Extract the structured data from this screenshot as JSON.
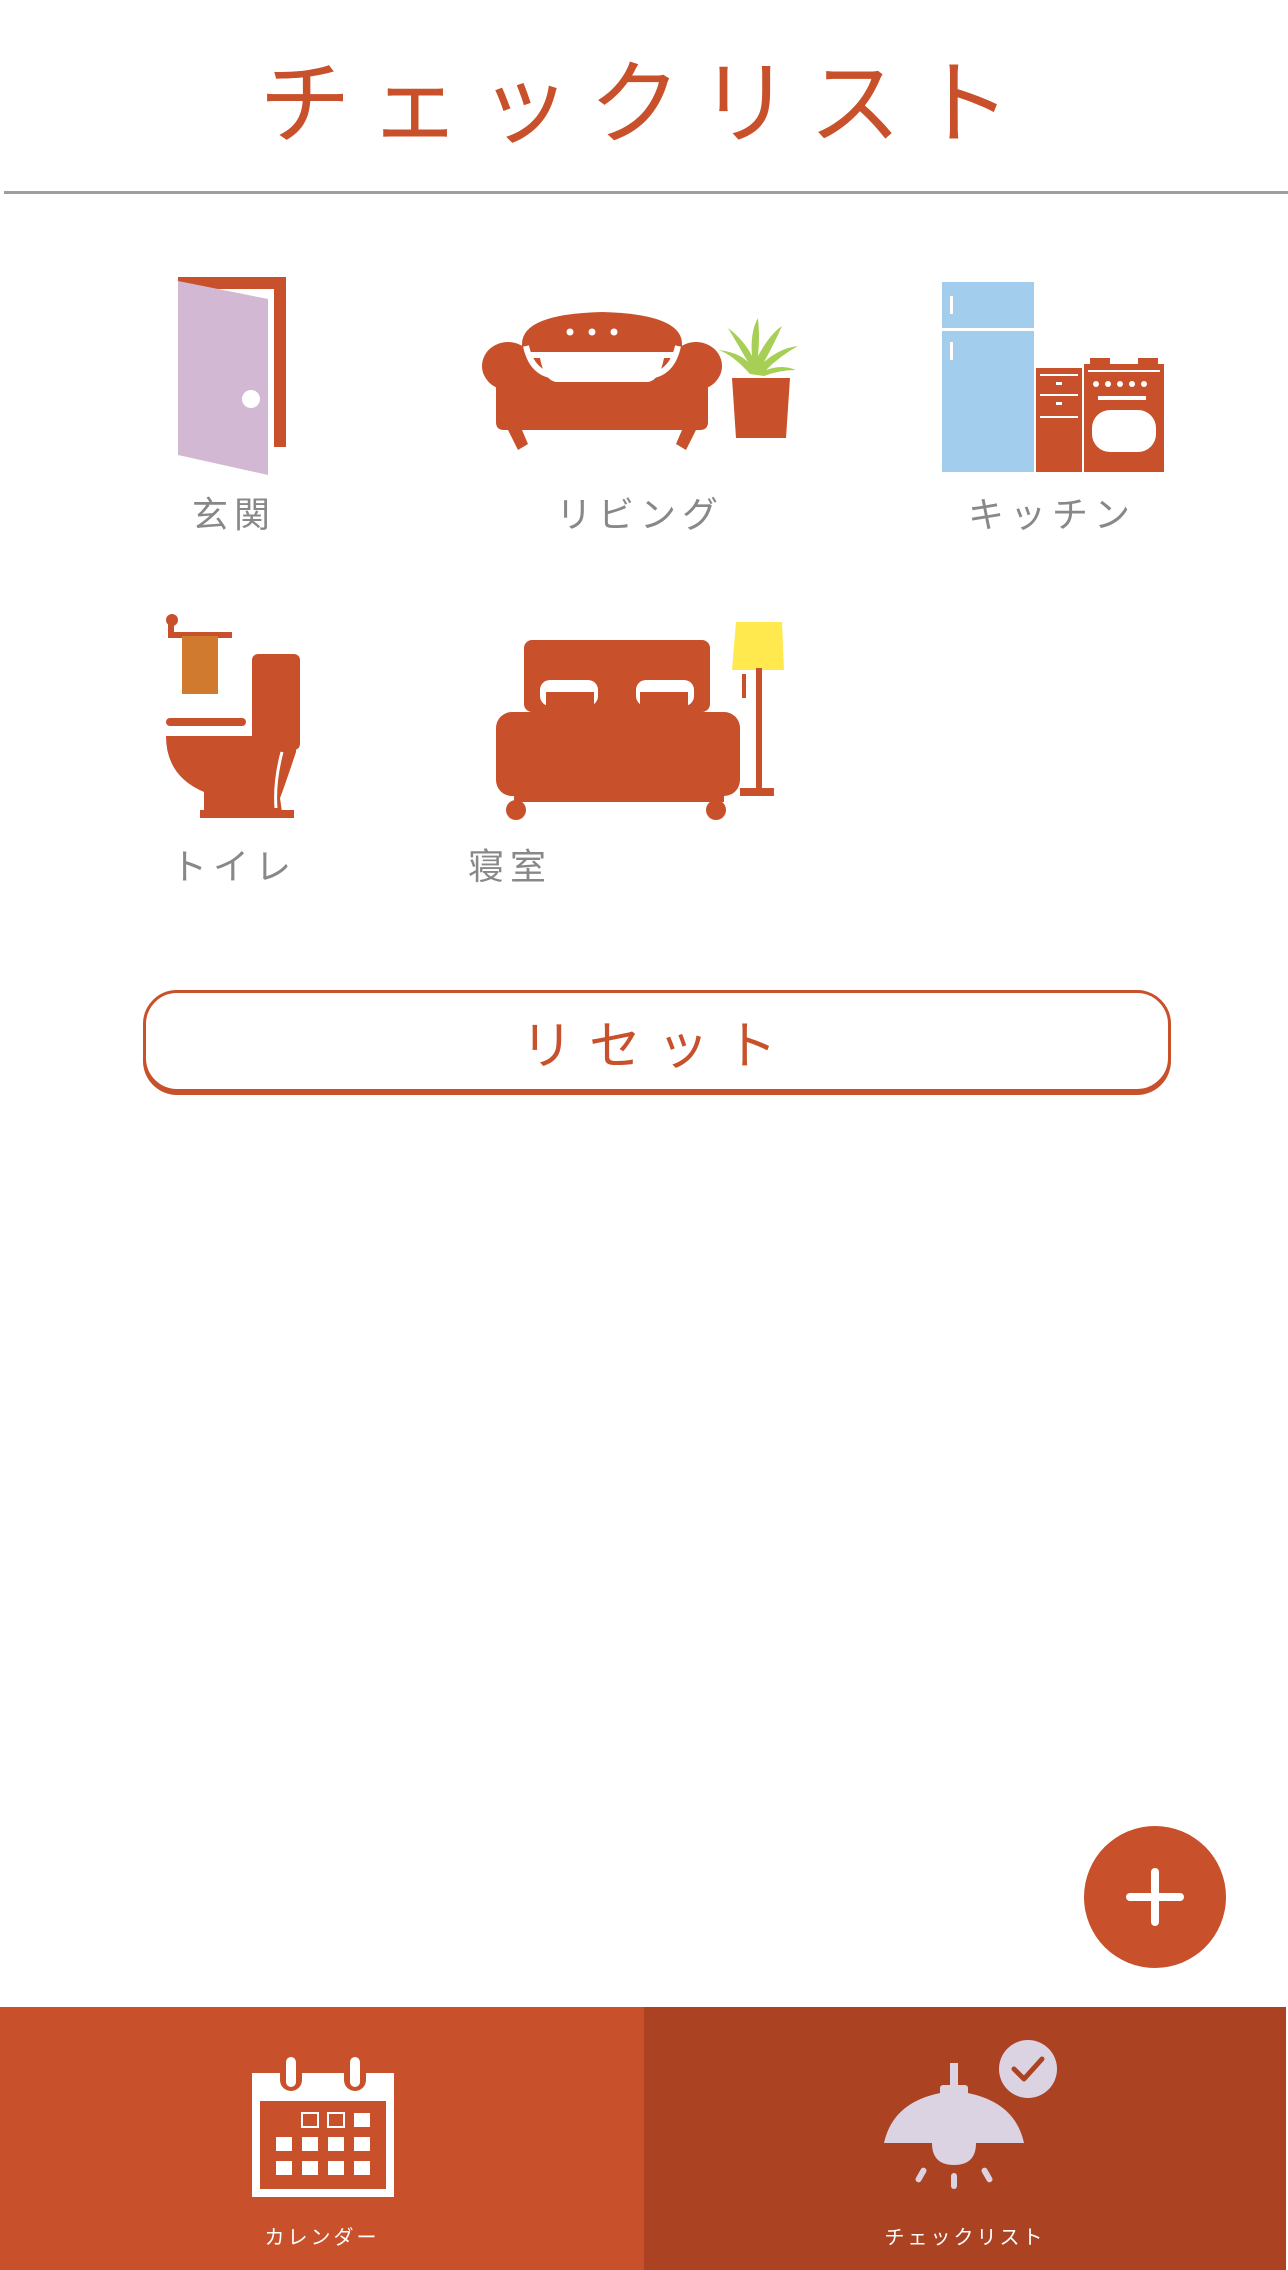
{
  "header": {
    "title": "チェックリスト"
  },
  "rooms": [
    {
      "label": "玄関",
      "icon": "door-icon"
    },
    {
      "label": "リビング",
      "icon": "sofa-icon"
    },
    {
      "label": "キッチン",
      "icon": "kitchen-icon"
    },
    {
      "label": "トイレ",
      "icon": "toilet-icon"
    },
    {
      "label": "寝室",
      "icon": "bed-icon"
    }
  ],
  "reset": {
    "label": "リセット"
  },
  "fab": {
    "icon": "plus-icon"
  },
  "tabs": [
    {
      "label": "カレンダー",
      "icon": "calendar-icon",
      "selected": false
    },
    {
      "label": "チェックリスト",
      "icon": "lamp-check-icon",
      "selected": true
    }
  ],
  "colors": {
    "accent": "#C8502A",
    "accent_dark": "#AB4222",
    "label_gray": "#888888",
    "door_panel": "#D3B8D3",
    "fridge": "#A2CDEC",
    "plant": "#A8CF55",
    "lampshade": "#FFE94F",
    "towel": "#D07A30"
  }
}
